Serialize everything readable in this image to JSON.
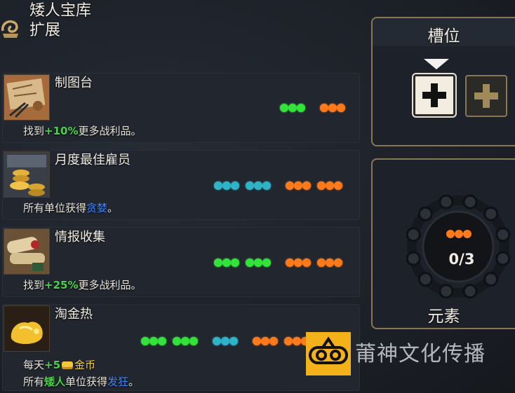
{
  "header": {
    "line1": "矮人宝库",
    "line2": "扩展"
  },
  "cards": [
    {
      "name": "制图台",
      "desc": [
        {
          "t": "找到",
          "c": ""
        },
        {
          "t": "+10%",
          "c": "g"
        },
        {
          "t": "更多战利品。",
          "c": ""
        }
      ],
      "groups": [
        {
          "color": "#33e23a",
          "count": 3
        },
        {
          "color": "#ff7a1a",
          "count": 3
        }
      ]
    },
    {
      "name": "月度最佳雇员",
      "desc": [
        {
          "t": "所有单位获得",
          "c": ""
        },
        {
          "t": "贪婪",
          "c": "b"
        },
        {
          "t": "。",
          "c": ""
        }
      ],
      "groups": [
        {
          "color": "#2fb3c6",
          "count": 3
        },
        {
          "color": "#2fb3c6",
          "count": 3
        },
        {
          "color": "#ff7a1a",
          "count": 3
        },
        {
          "color": "#ff7a1a",
          "count": 3
        }
      ]
    },
    {
      "name": "情报收集",
      "desc": [
        {
          "t": "找到",
          "c": ""
        },
        {
          "t": "+25%",
          "c": "g"
        },
        {
          "t": "更多战利品。",
          "c": ""
        }
      ],
      "groups": [
        {
          "color": "#33e23a",
          "count": 3
        },
        {
          "color": "#33e23a",
          "count": 3
        },
        {
          "color": "#ff7a1a",
          "count": 3
        },
        {
          "color": "#ff7a1a",
          "count": 3
        }
      ]
    },
    {
      "name": "淘金热",
      "desc": [
        {
          "t": "每天",
          "c": ""
        },
        {
          "t": "+5",
          "c": "g"
        },
        {
          "t": "金币",
          "c": "y",
          "icon": "coin-icon"
        }
      ],
      "desc2": [
        {
          "t": "所有",
          "c": ""
        },
        {
          "t": "矮人",
          "c": "g"
        },
        {
          "t": "单位获得",
          "c": ""
        },
        {
          "t": "发狂",
          "c": "b"
        },
        {
          "t": "。",
          "c": ""
        }
      ],
      "groups": [
        {
          "color": "#33e23a",
          "count": 3
        },
        {
          "color": "#33e23a",
          "count": 3
        },
        {
          "color": "#2fb3c6",
          "count": 3
        },
        {
          "color": "#ff7a1a",
          "count": 3
        },
        {
          "color": "#ff7a1a",
          "count": 3
        }
      ]
    }
  ],
  "slots_panel": {
    "title": "槽位",
    "add_icon": "plus-icon"
  },
  "elements_panel": {
    "title": "元素",
    "count": "0/3",
    "ring_nodes": 12
  },
  "watermark": {
    "text": "莆神文化传播"
  }
}
